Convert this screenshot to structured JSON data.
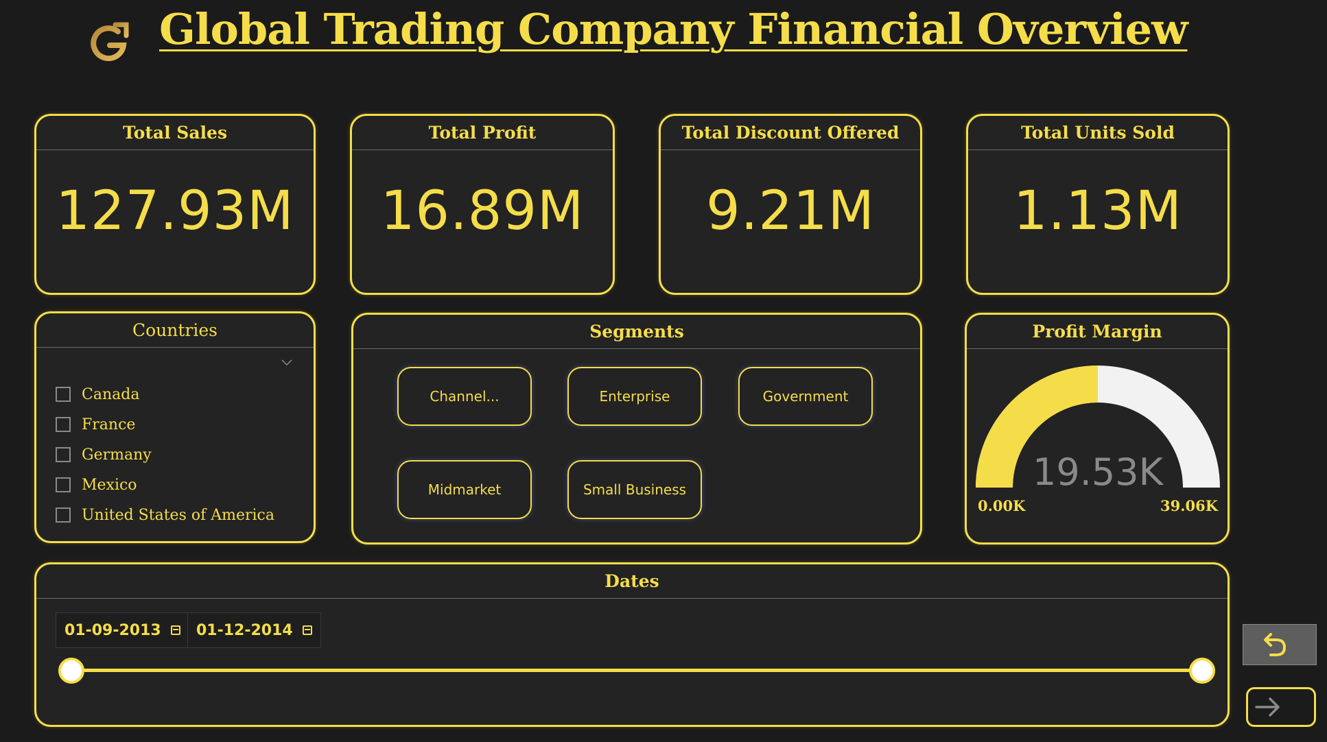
{
  "header": {
    "title": "Global Trading Company Financial Overview",
    "logo_icon": "gt-logo-icon"
  },
  "kpis": {
    "sales": {
      "label": "Total Sales",
      "value": "127.93M"
    },
    "profit": {
      "label": "Total Profit",
      "value": "16.89M"
    },
    "discount": {
      "label": "Total Discount Offered",
      "value": "9.21M"
    },
    "units": {
      "label": "Total Units Sold",
      "value": "1.13M"
    }
  },
  "countries": {
    "title": "Countries",
    "items": [
      "Canada",
      "France",
      "Germany",
      "Mexico",
      "United States of America"
    ]
  },
  "segments": {
    "title": "Segments",
    "items": [
      "Channel...",
      "Enterprise",
      "Government",
      "Midmarket",
      "Small Business"
    ]
  },
  "profit_margin": {
    "title": "Profit Margin",
    "value_label": "19.53K",
    "min_label": "0.00K",
    "max_label": "39.06K",
    "value": 19.53,
    "min": 0,
    "max": 39.06
  },
  "dates": {
    "title": "Dates",
    "start": "01-09-2013",
    "end": "01-12-2014"
  },
  "colors": {
    "accent": "#f5dd4a",
    "background": "#1b1b1b",
    "card": "#232323",
    "gauge_rest": "#f2f2f2"
  }
}
